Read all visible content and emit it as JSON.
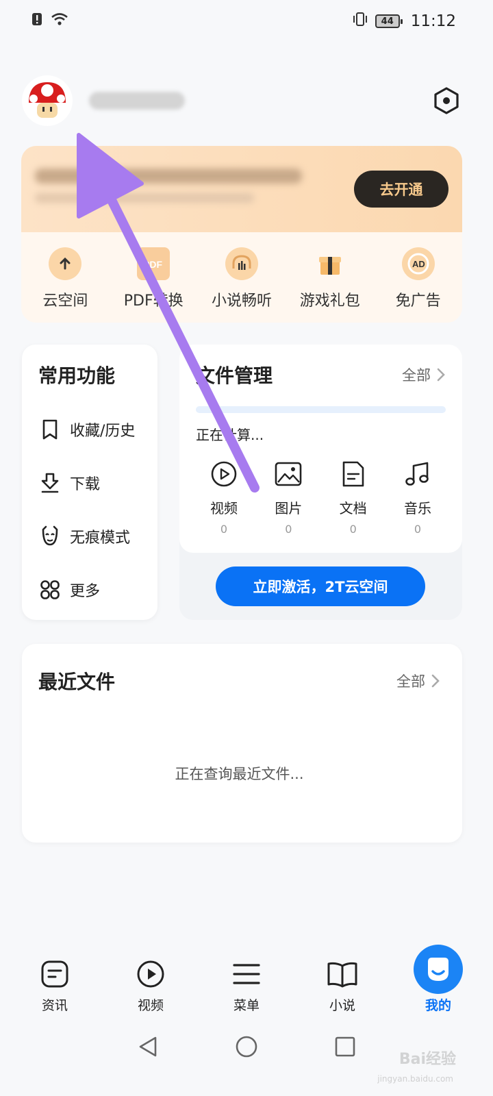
{
  "status_bar": {
    "time": "11:12",
    "battery": "44"
  },
  "vip": {
    "open_button": "去开通"
  },
  "vip_items": [
    {
      "label": "云空间",
      "icon": "cloud-upload-icon"
    },
    {
      "label": "PDF转换",
      "icon": "pdf-icon"
    },
    {
      "label": "小说畅听",
      "icon": "headphones-icon"
    },
    {
      "label": "游戏礼包",
      "icon": "gift-icon"
    },
    {
      "label": "免广告",
      "icon": "ad-block-icon"
    }
  ],
  "common": {
    "title": "常用功能",
    "items": [
      {
        "label": "收藏/历史",
        "icon": "bookmark-icon"
      },
      {
        "label": "下载",
        "icon": "download-icon"
      },
      {
        "label": "无痕模式",
        "icon": "incognito-icon"
      },
      {
        "label": "更多",
        "icon": "grid-icon"
      }
    ]
  },
  "files": {
    "title": "文件管理",
    "all_label": "全部",
    "status": "正在计算...",
    "types": [
      {
        "label": "视频",
        "count": "0",
        "icon": "play-icon"
      },
      {
        "label": "图片",
        "count": "0",
        "icon": "image-icon"
      },
      {
        "label": "文档",
        "count": "0",
        "icon": "document-icon"
      },
      {
        "label": "音乐",
        "count": "0",
        "icon": "music-icon"
      }
    ],
    "activate_button": "立即激活，2T云空间"
  },
  "recent": {
    "title": "最近文件",
    "all_label": "全部",
    "loading": "正在查询最近文件..."
  },
  "tabs": [
    {
      "label": "资讯",
      "icon": "news-icon"
    },
    {
      "label": "视频",
      "icon": "video-play-icon"
    },
    {
      "label": "菜单",
      "icon": "menu-icon"
    },
    {
      "label": "小说",
      "icon": "book-icon"
    },
    {
      "label": "我的",
      "icon": "me-icon",
      "active": true
    }
  ],
  "watermark": {
    "brand": "Bai经验",
    "url": "jingyan.baidu.com"
  },
  "colors": {
    "accent": "#0a72f5",
    "vip_dark": "#2a2622",
    "vip_gold": "#f7c98c",
    "annotation": "#a77bef"
  }
}
